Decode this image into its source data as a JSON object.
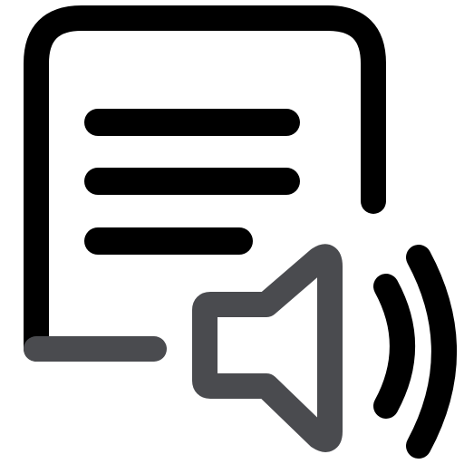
{
  "icon": {
    "name": "text-to-speech-icon",
    "parts": [
      "document-frame",
      "text-lines",
      "speaker",
      "sound-waves"
    ]
  },
  "colors": {
    "primary_stroke": "#000000",
    "secondary_stroke": "#4a4b4f",
    "background": "#ffffff"
  }
}
